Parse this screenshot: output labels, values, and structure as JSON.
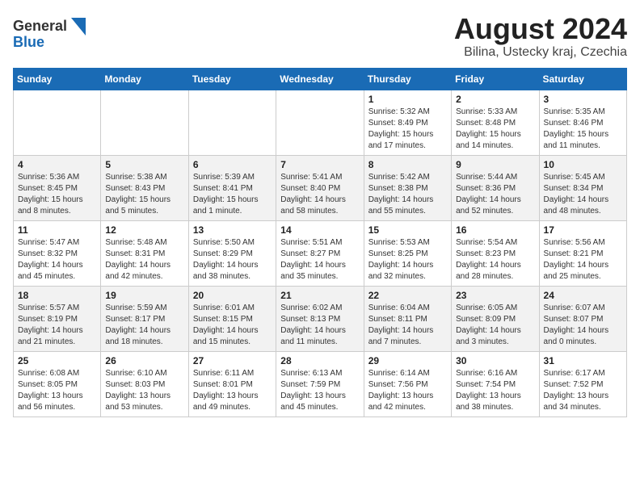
{
  "header": {
    "logo_line1": "General",
    "logo_line2": "Blue",
    "month_year": "August 2024",
    "location": "Bilina, Ustecky kraj, Czechia"
  },
  "weekdays": [
    "Sunday",
    "Monday",
    "Tuesday",
    "Wednesday",
    "Thursday",
    "Friday",
    "Saturday"
  ],
  "weeks": [
    [
      {
        "day": "",
        "info": ""
      },
      {
        "day": "",
        "info": ""
      },
      {
        "day": "",
        "info": ""
      },
      {
        "day": "",
        "info": ""
      },
      {
        "day": "1",
        "info": "Sunrise: 5:32 AM\nSunset: 8:49 PM\nDaylight: 15 hours\nand 17 minutes."
      },
      {
        "day": "2",
        "info": "Sunrise: 5:33 AM\nSunset: 8:48 PM\nDaylight: 15 hours\nand 14 minutes."
      },
      {
        "day": "3",
        "info": "Sunrise: 5:35 AM\nSunset: 8:46 PM\nDaylight: 15 hours\nand 11 minutes."
      }
    ],
    [
      {
        "day": "4",
        "info": "Sunrise: 5:36 AM\nSunset: 8:45 PM\nDaylight: 15 hours\nand 8 minutes."
      },
      {
        "day": "5",
        "info": "Sunrise: 5:38 AM\nSunset: 8:43 PM\nDaylight: 15 hours\nand 5 minutes."
      },
      {
        "day": "6",
        "info": "Sunrise: 5:39 AM\nSunset: 8:41 PM\nDaylight: 15 hours\nand 1 minute."
      },
      {
        "day": "7",
        "info": "Sunrise: 5:41 AM\nSunset: 8:40 PM\nDaylight: 14 hours\nand 58 minutes."
      },
      {
        "day": "8",
        "info": "Sunrise: 5:42 AM\nSunset: 8:38 PM\nDaylight: 14 hours\nand 55 minutes."
      },
      {
        "day": "9",
        "info": "Sunrise: 5:44 AM\nSunset: 8:36 PM\nDaylight: 14 hours\nand 52 minutes."
      },
      {
        "day": "10",
        "info": "Sunrise: 5:45 AM\nSunset: 8:34 PM\nDaylight: 14 hours\nand 48 minutes."
      }
    ],
    [
      {
        "day": "11",
        "info": "Sunrise: 5:47 AM\nSunset: 8:32 PM\nDaylight: 14 hours\nand 45 minutes."
      },
      {
        "day": "12",
        "info": "Sunrise: 5:48 AM\nSunset: 8:31 PM\nDaylight: 14 hours\nand 42 minutes."
      },
      {
        "day": "13",
        "info": "Sunrise: 5:50 AM\nSunset: 8:29 PM\nDaylight: 14 hours\nand 38 minutes."
      },
      {
        "day": "14",
        "info": "Sunrise: 5:51 AM\nSunset: 8:27 PM\nDaylight: 14 hours\nand 35 minutes."
      },
      {
        "day": "15",
        "info": "Sunrise: 5:53 AM\nSunset: 8:25 PM\nDaylight: 14 hours\nand 32 minutes."
      },
      {
        "day": "16",
        "info": "Sunrise: 5:54 AM\nSunset: 8:23 PM\nDaylight: 14 hours\nand 28 minutes."
      },
      {
        "day": "17",
        "info": "Sunrise: 5:56 AM\nSunset: 8:21 PM\nDaylight: 14 hours\nand 25 minutes."
      }
    ],
    [
      {
        "day": "18",
        "info": "Sunrise: 5:57 AM\nSunset: 8:19 PM\nDaylight: 14 hours\nand 21 minutes."
      },
      {
        "day": "19",
        "info": "Sunrise: 5:59 AM\nSunset: 8:17 PM\nDaylight: 14 hours\nand 18 minutes."
      },
      {
        "day": "20",
        "info": "Sunrise: 6:01 AM\nSunset: 8:15 PM\nDaylight: 14 hours\nand 15 minutes."
      },
      {
        "day": "21",
        "info": "Sunrise: 6:02 AM\nSunset: 8:13 PM\nDaylight: 14 hours\nand 11 minutes."
      },
      {
        "day": "22",
        "info": "Sunrise: 6:04 AM\nSunset: 8:11 PM\nDaylight: 14 hours\nand 7 minutes."
      },
      {
        "day": "23",
        "info": "Sunrise: 6:05 AM\nSunset: 8:09 PM\nDaylight: 14 hours\nand 3 minutes."
      },
      {
        "day": "24",
        "info": "Sunrise: 6:07 AM\nSunset: 8:07 PM\nDaylight: 14 hours\nand 0 minutes."
      }
    ],
    [
      {
        "day": "25",
        "info": "Sunrise: 6:08 AM\nSunset: 8:05 PM\nDaylight: 13 hours\nand 56 minutes."
      },
      {
        "day": "26",
        "info": "Sunrise: 6:10 AM\nSunset: 8:03 PM\nDaylight: 13 hours\nand 53 minutes."
      },
      {
        "day": "27",
        "info": "Sunrise: 6:11 AM\nSunset: 8:01 PM\nDaylight: 13 hours\nand 49 minutes."
      },
      {
        "day": "28",
        "info": "Sunrise: 6:13 AM\nSunset: 7:59 PM\nDaylight: 13 hours\nand 45 minutes."
      },
      {
        "day": "29",
        "info": "Sunrise: 6:14 AM\nSunset: 7:56 PM\nDaylight: 13 hours\nand 42 minutes."
      },
      {
        "day": "30",
        "info": "Sunrise: 6:16 AM\nSunset: 7:54 PM\nDaylight: 13 hours\nand 38 minutes."
      },
      {
        "day": "31",
        "info": "Sunrise: 6:17 AM\nSunset: 7:52 PM\nDaylight: 13 hours\nand 34 minutes."
      }
    ]
  ]
}
